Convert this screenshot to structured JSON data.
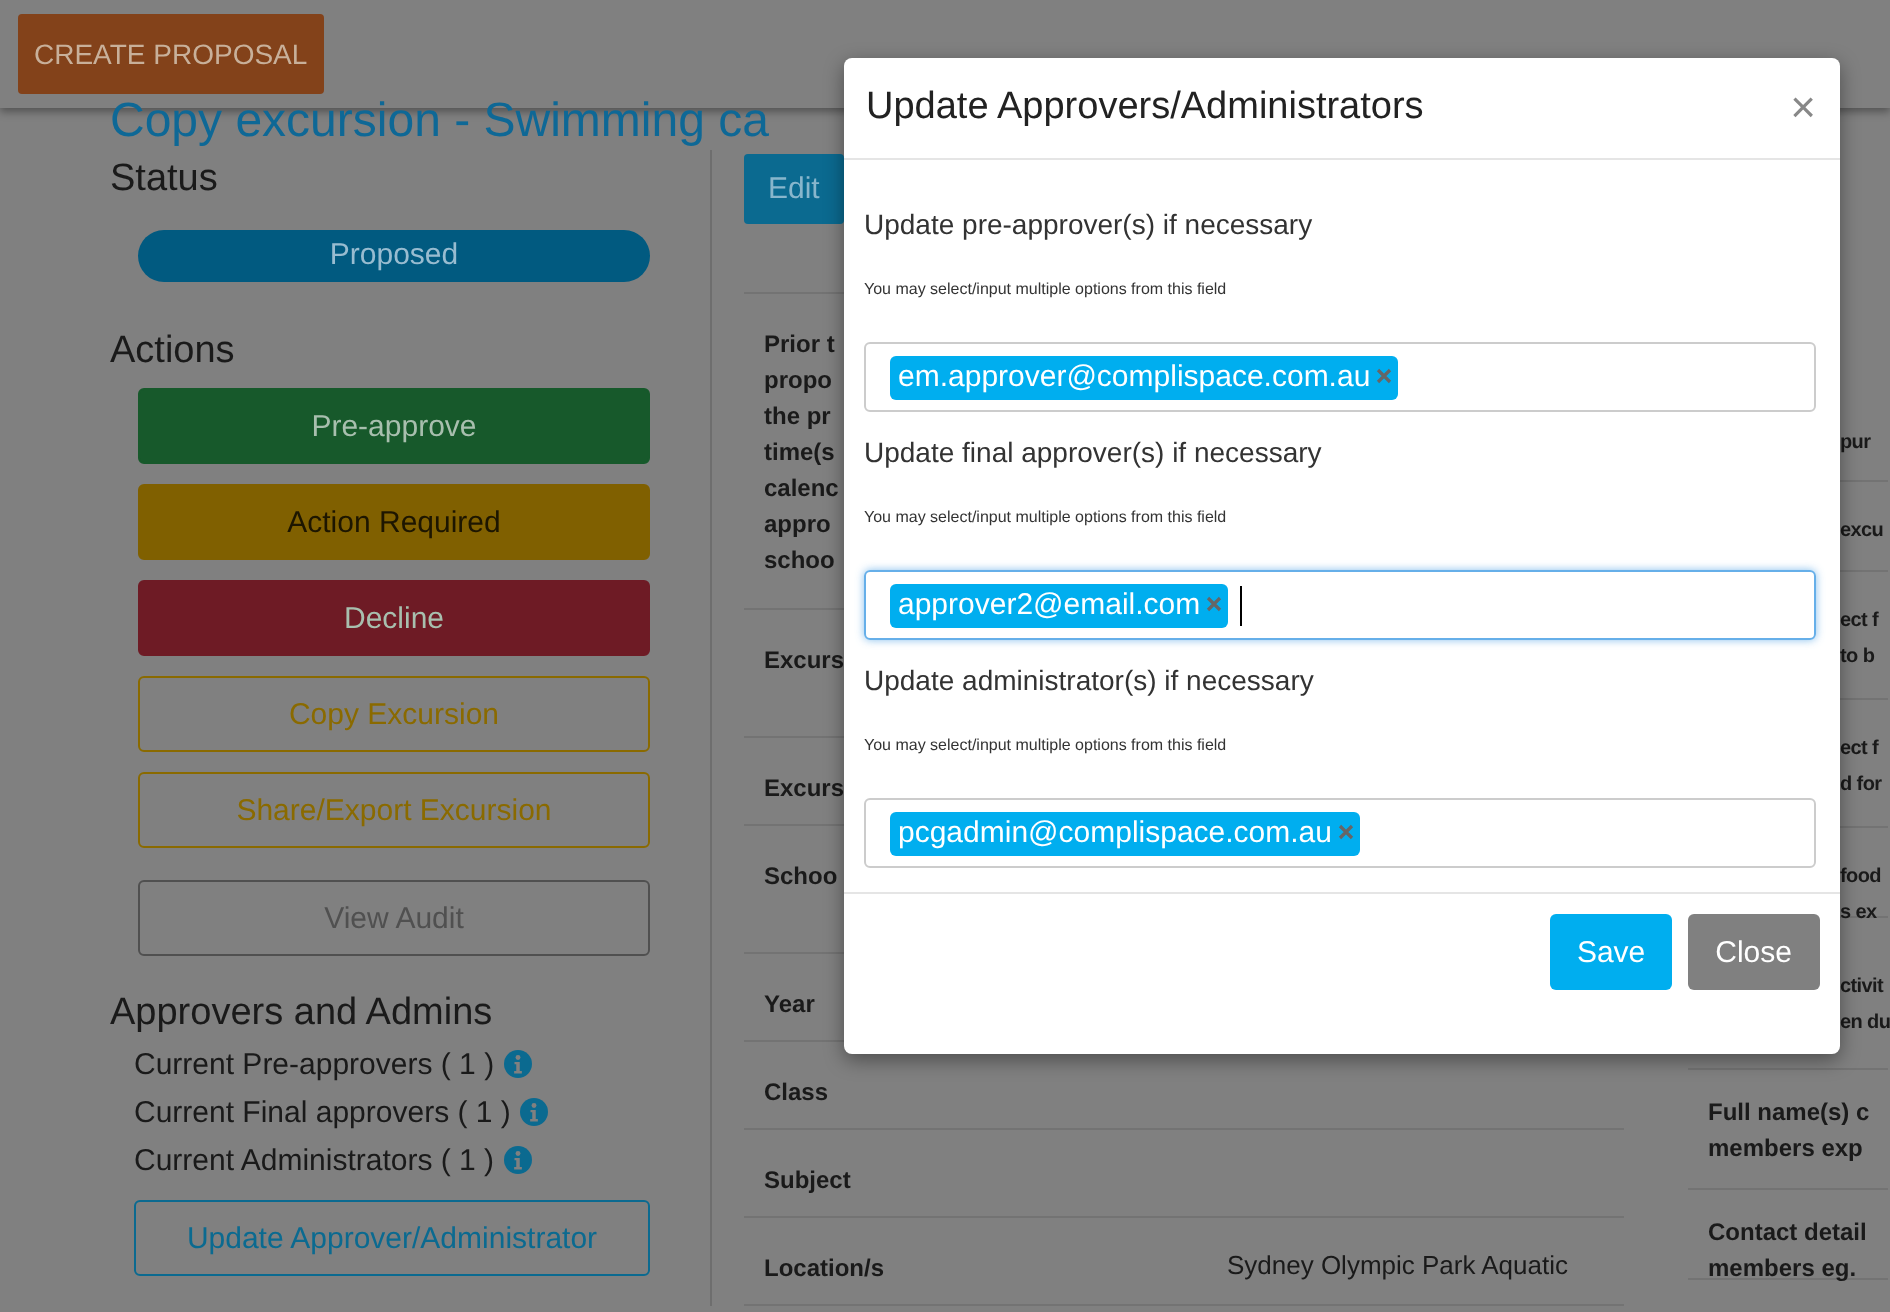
{
  "header": {
    "create_button": "CREATE PROPOSAL"
  },
  "page_title": "Copy excursion - Swimming ca",
  "status": {
    "heading": "Status",
    "value": "Proposed"
  },
  "actions": {
    "heading": "Actions",
    "buttons": [
      {
        "label": "Pre-approve",
        "kind": "solid",
        "color": "#17592b"
      },
      {
        "label": "Action Required",
        "kind": "solid",
        "color": "#806000"
      },
      {
        "label": "Decline",
        "kind": "solid",
        "color": "#6e1b25"
      },
      {
        "label": "Copy Excursion",
        "kind": "outline",
        "color": "#8a6a00"
      },
      {
        "label": "Share/Export Excursion",
        "kind": "outline",
        "color": "#8a6a00"
      },
      {
        "label": "View Audit",
        "kind": "outline",
        "color": "#505050"
      }
    ]
  },
  "approvers": {
    "heading": "Approvers and Admins",
    "items": [
      {
        "text": "Current Pre-approvers ( 1 )"
      },
      {
        "text": "Current Final approvers ( 1 )"
      },
      {
        "text": "Current Administrators ( 1 )"
      }
    ],
    "update_button": "Update Approver/Administrator"
  },
  "edit_button": "Edit",
  "details_rows": [
    {
      "label": "Prior t\npropo\nthe pr\ntime(s\ncalenc\nappro\nschoo"
    },
    {
      "label": "Excurs"
    },
    {
      "label": "Excurs"
    },
    {
      "label": "Schoo"
    },
    {
      "label": "Year"
    },
    {
      "label": "Class"
    },
    {
      "label": "Subject"
    },
    {
      "label": "Location/s",
      "value": "Sydney Olympic Park Aquatic"
    }
  ],
  "side_rows": [
    {
      "label": "pur"
    },
    {
      "label": "excu"
    },
    {
      "label": "ect f\nto b"
    },
    {
      "label": "ect f\nd for"
    },
    {
      "label": "food\ns ex"
    },
    {
      "label": "ctivit\nen du"
    },
    {
      "label": "Full name(s) c\nmembers exp"
    },
    {
      "label": "Contact detail\nmembers eg."
    }
  ],
  "modal": {
    "title": "Update Approvers/Administrators",
    "close": "×",
    "fields": [
      {
        "label": "Update pre-approver(s) if necessary",
        "hint": "You may select/input multiple options from this field",
        "tags": [
          "em.approver@complispace.com.au"
        ],
        "focused": false
      },
      {
        "label": "Update final approver(s) if necessary",
        "hint": "You may select/input multiple options from this field",
        "tags": [
          "approver2@email.com"
        ],
        "focused": true
      },
      {
        "label": "Update administrator(s) if necessary",
        "hint": "You may select/input multiple options from this field",
        "tags": [
          "pcgadmin@complispace.com.au"
        ],
        "focused": false
      }
    ],
    "buttons": [
      {
        "label": "Save",
        "kind": "primary"
      },
      {
        "label": "Close",
        "kind": "secondary"
      }
    ]
  }
}
